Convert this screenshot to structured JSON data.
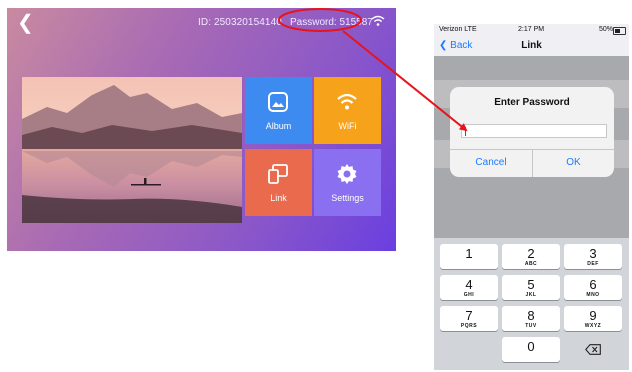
{
  "device": {
    "id_text": "ID: 250320154140",
    "password_text": "Password: 515587",
    "tiles": [
      {
        "label": "Album",
        "icon": "album-icon",
        "color": "#3d8bf0"
      },
      {
        "label": "WiFi",
        "icon": "wifi-icon",
        "color": "#f6a21b"
      },
      {
        "label": "Link",
        "icon": "link-screen-icon",
        "color": "#ea6a4d"
      },
      {
        "label": "Settings",
        "icon": "gear-icon",
        "color": "#8a6ff0"
      }
    ]
  },
  "annotation": {
    "color": "#e8141c"
  },
  "phone": {
    "status": {
      "carrier": "Verizon LTE",
      "time": "2:17 PM",
      "battery": "50%"
    },
    "nav": {
      "back": "Back",
      "title": "Link"
    },
    "dialog": {
      "title": "Enter Password",
      "cancel": "Cancel",
      "ok": "OK",
      "input_value": ""
    },
    "keypad": [
      {
        "n": "1",
        "l": ""
      },
      {
        "n": "2",
        "l": "ABC"
      },
      {
        "n": "3",
        "l": "DEF"
      },
      {
        "n": "4",
        "l": "GHI"
      },
      {
        "n": "5",
        "l": "JKL"
      },
      {
        "n": "6",
        "l": "MNO"
      },
      {
        "n": "7",
        "l": "PQRS"
      },
      {
        "n": "8",
        "l": "TUV"
      },
      {
        "n": "9",
        "l": "WXYZ"
      },
      {
        "n": "0",
        "l": ""
      }
    ]
  }
}
